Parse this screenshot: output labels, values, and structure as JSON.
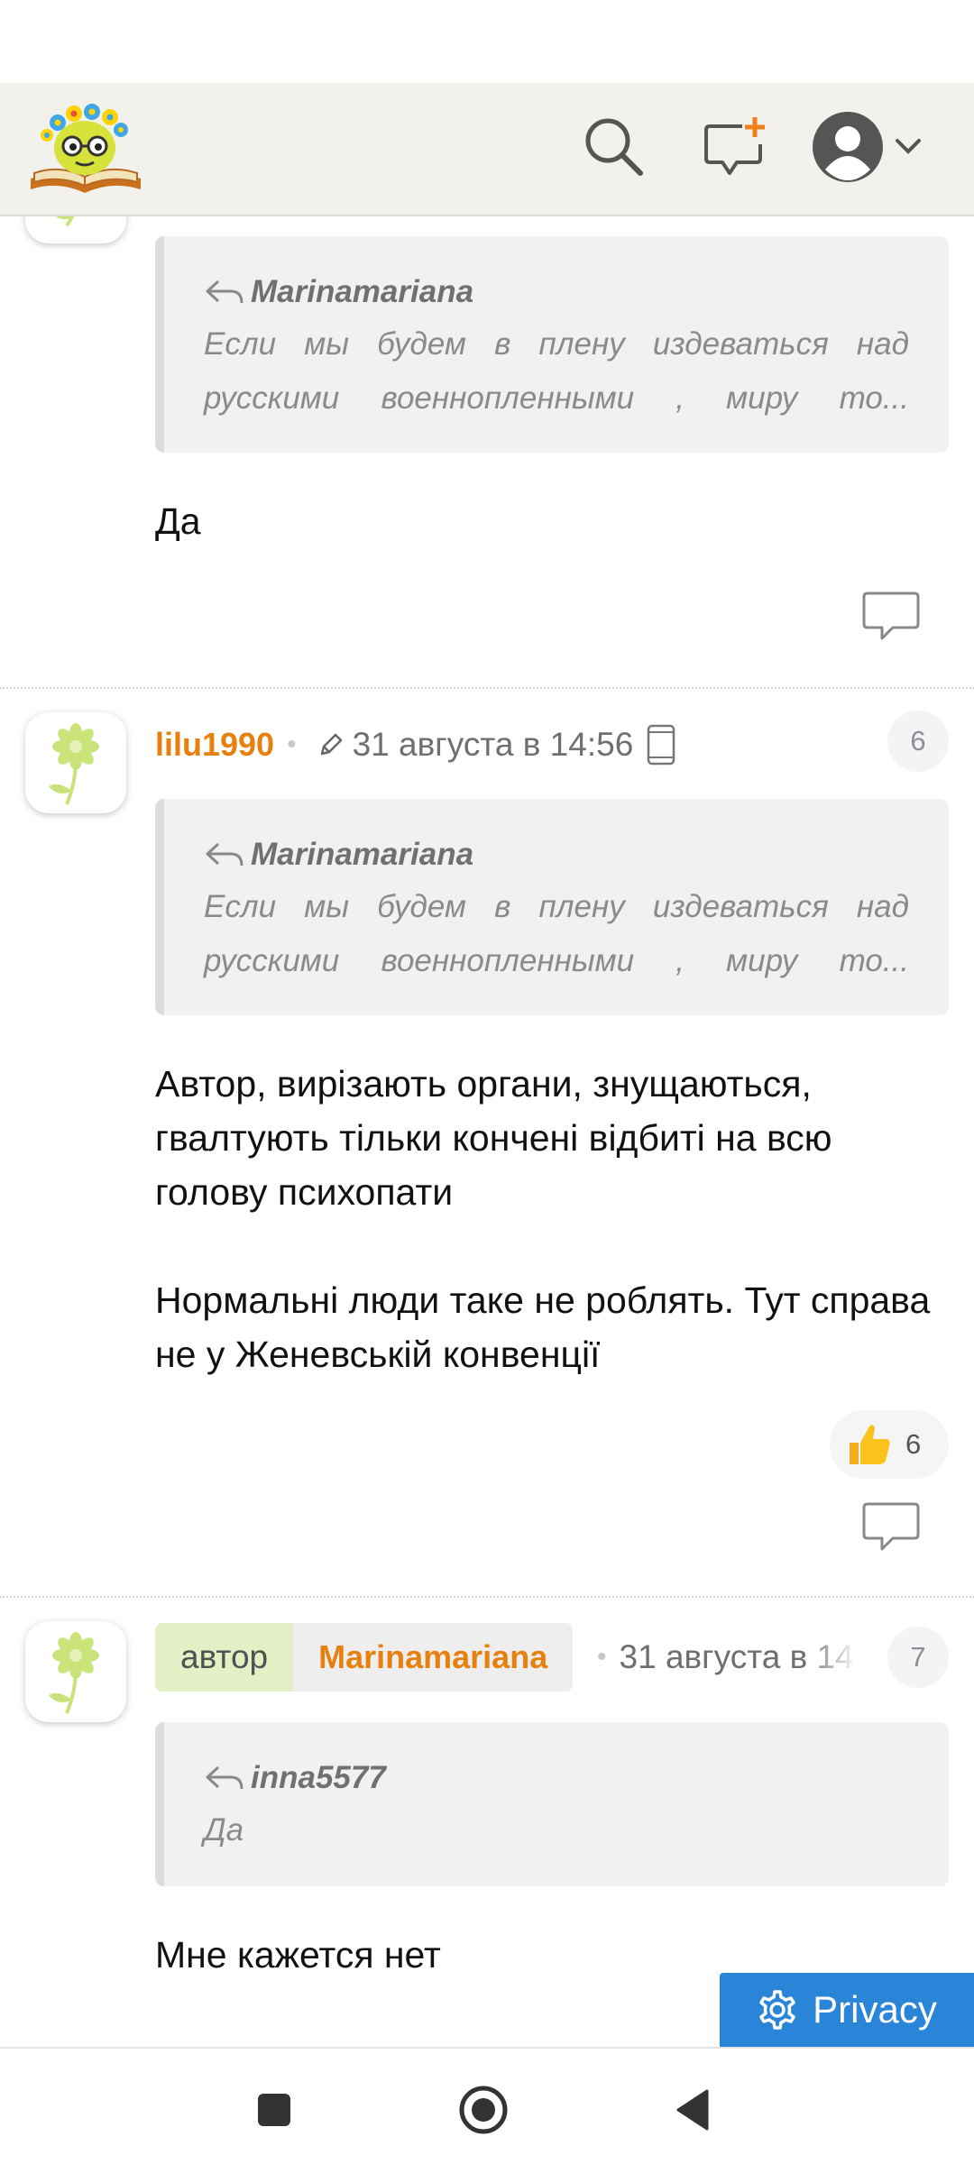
{
  "header": {
    "logo_icon": "book-flower-mascot-logo",
    "search_icon": "search-icon",
    "new_topic_icon": "new-message-plus-icon",
    "user_icon": "user-avatar-icon"
  },
  "posts": [
    {
      "quote": {
        "author": "Marinamariana",
        "text_line1": "Если мы будем в плену издеваться над",
        "text_line2": "русскими военнопленными , миру то..."
      },
      "body": "Да"
    },
    {
      "username": "lilu1990",
      "date": "31 августа в 14:56",
      "number": "6",
      "quote": {
        "author": "Marinamariana",
        "text_line1": "Если мы будем в плену издеваться над",
        "text_line2": "русскими военнопленными , миру то..."
      },
      "body_p1": "Автор, вирізають органи, знущаються, гвалтують тільки кончені відбиті на всю голову психопати",
      "body_p2": "Нормальні люди таке не роблять. Тут справа не у Женевській конвенції",
      "likes": "6"
    },
    {
      "author_tag": "автор",
      "username": "Marinamariana",
      "date": "31 августа в 14",
      "number": "7",
      "quote": {
        "author": "inna5577",
        "text": "Да"
      },
      "body": "Мне кажется нет"
    }
  ],
  "privacy_label": "Privacy",
  "colors": {
    "username": "#e8800f",
    "privacy_bg": "#2a84d8",
    "author_tag_bg": "#e3efc4",
    "header_bg": "#f2f1ec"
  }
}
